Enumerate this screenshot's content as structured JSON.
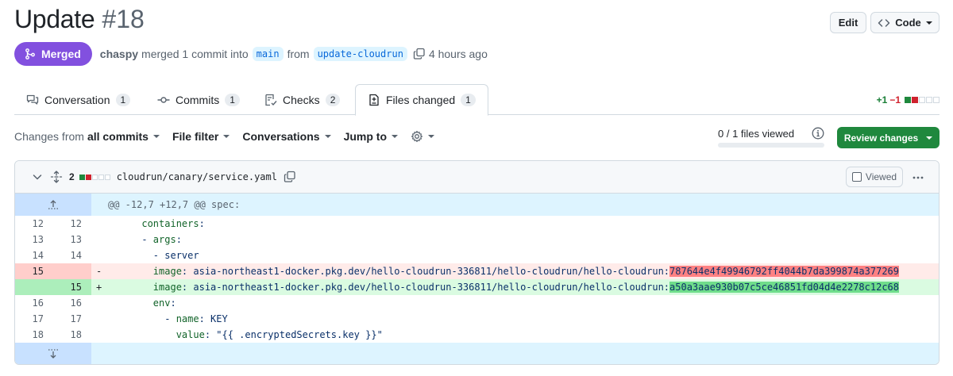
{
  "pr": {
    "title": "Update",
    "number": "#18",
    "state_label": "Merged",
    "author": "chaspy",
    "merged_text": "merged 1 commit into",
    "base_branch": "main",
    "from_text": "from",
    "head_branch": "update-cloudrun",
    "time_ago": "4 hours ago"
  },
  "header_buttons": {
    "edit": "Edit",
    "code": "Code"
  },
  "tabs": [
    {
      "label": "Conversation",
      "count": "1",
      "icon": "comment-discussion-icon"
    },
    {
      "label": "Commits",
      "count": "1",
      "icon": "git-commit-icon"
    },
    {
      "label": "Checks",
      "count": "2",
      "icon": "checklist-icon"
    },
    {
      "label": "Files changed",
      "count": "1",
      "icon": "file-diff-icon"
    }
  ],
  "diffstat": {
    "additions": "+1",
    "deletions": "−1"
  },
  "toolbar": {
    "changes_from_prefix": "Changes from",
    "changes_from_value": "all commits",
    "file_filter": "File filter",
    "conversations": "Conversations",
    "jump_to": "Jump to",
    "files_viewed": "0 / 1 files viewed",
    "files_viewed_fraction": 0,
    "review_changes": "Review changes"
  },
  "file": {
    "change_count": "2",
    "path": "cloudrun/canary/service.yaml",
    "viewed_label": "Viewed",
    "hunk_header": "@@ -12,7 +12,7 @@ spec:",
    "lines": [
      {
        "old": "12",
        "new": "12",
        "sign": "",
        "type": "ctx",
        "indent": "      ",
        "key": "containers",
        "rest": ":"
      },
      {
        "old": "13",
        "new": "13",
        "sign": "",
        "type": "ctx",
        "indent": "      - ",
        "key": "args",
        "rest": ":"
      },
      {
        "old": "14",
        "new": "14",
        "sign": "",
        "type": "ctx",
        "indent": "        - ",
        "key": "",
        "rest": "server"
      },
      {
        "old": "15",
        "new": "",
        "sign": "-",
        "type": "del",
        "indent": "        ",
        "key": "image",
        "rest": ": asia-northeast1-docker.pkg.dev/hello-cloudrun-336811/hello-cloudrun/hello-cloudrun:",
        "hl": "787644e4f49946792ff4044b7da399874a377269"
      },
      {
        "old": "",
        "new": "15",
        "sign": "+",
        "type": "add",
        "indent": "        ",
        "key": "image",
        "rest": ": asia-northeast1-docker.pkg.dev/hello-cloudrun-336811/hello-cloudrun/hello-cloudrun:",
        "hl": "a50a3aae930b07c5ce46851fd04d4e2278c12c68"
      },
      {
        "old": "16",
        "new": "16",
        "sign": "",
        "type": "ctx",
        "indent": "        ",
        "key": "env",
        "rest": ":"
      },
      {
        "old": "17",
        "new": "17",
        "sign": "",
        "type": "ctx",
        "indent": "          - ",
        "key": "name",
        "rest": ": KEY"
      },
      {
        "old": "18",
        "new": "18",
        "sign": "",
        "type": "ctx",
        "indent": "            ",
        "key": "value",
        "rest": ": \"{{ .encryptedSecrets.key }}\""
      }
    ]
  }
}
